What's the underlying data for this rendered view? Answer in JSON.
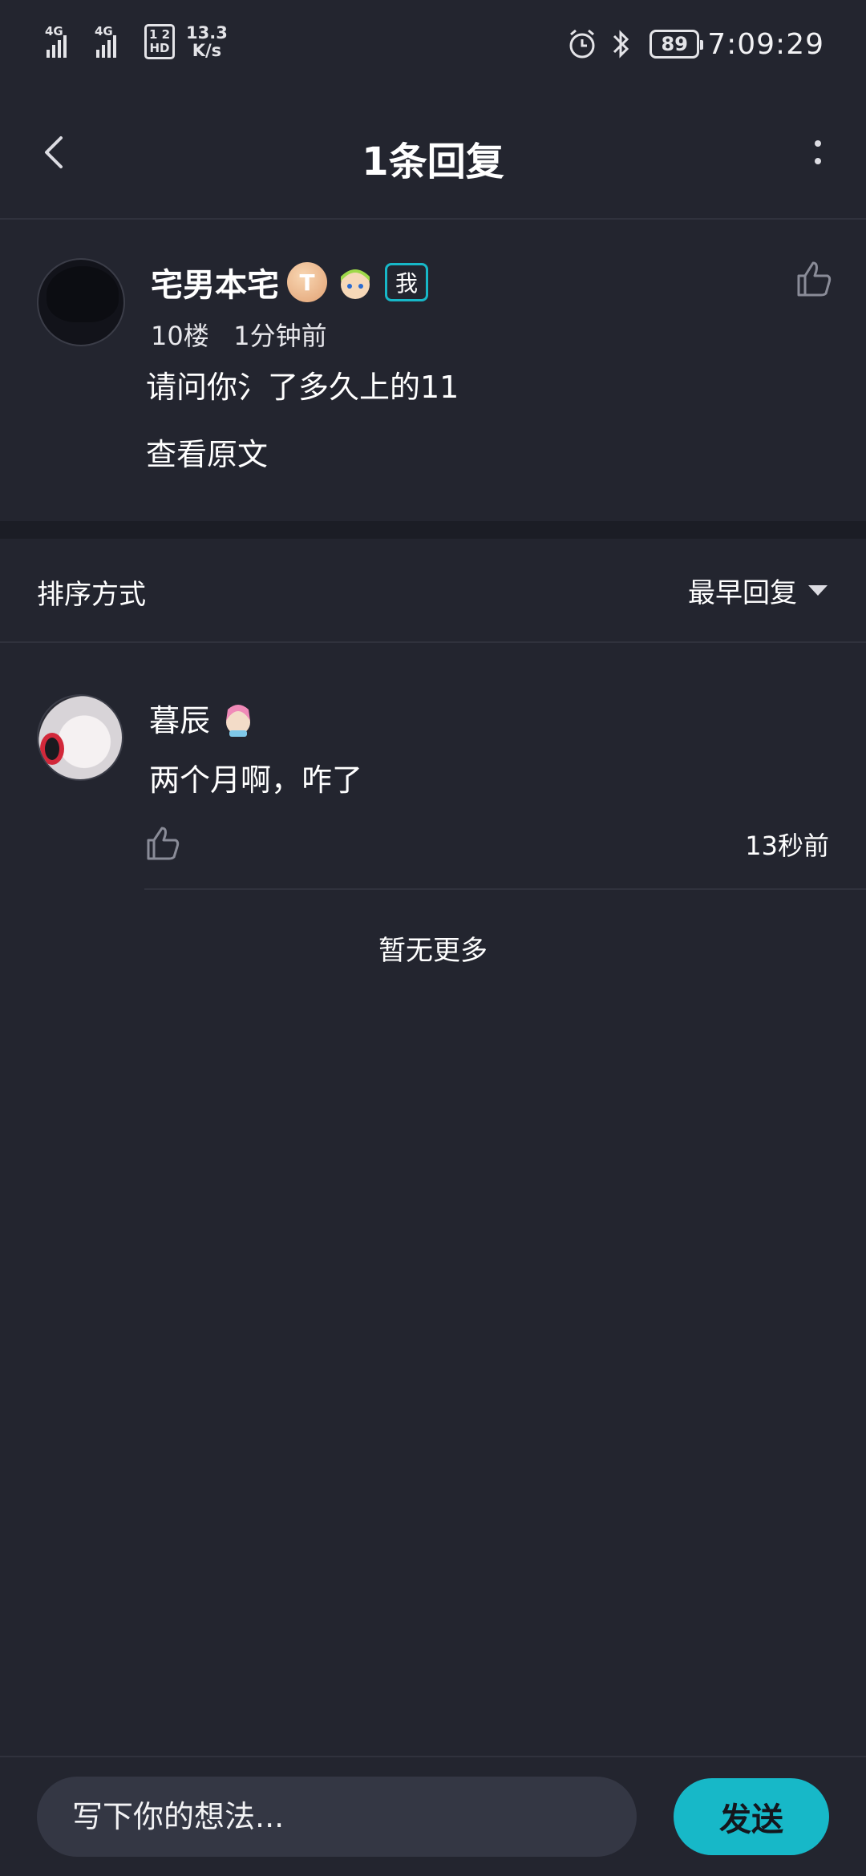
{
  "status_bar": {
    "network_1": "4G",
    "network_2": "4G",
    "hd_badge": "1 2\nHD",
    "speed_value": "13.3",
    "speed_unit": "K/s",
    "battery": "89",
    "time": "7:09:29"
  },
  "header": {
    "title": "1条回复"
  },
  "comment": {
    "author": "宅男本宅",
    "level_badge": "T",
    "me_tag": "我",
    "floor": "10楼",
    "time": "1分钟前",
    "text": "请问你氵了多久上的11",
    "view_original": "查看原文"
  },
  "sort": {
    "label": "排序方式",
    "selected": "最早回复"
  },
  "replies": [
    {
      "author": "暮辰",
      "text": "两个月啊，咋了",
      "time": "13秒前"
    }
  ],
  "list_end": "暂无更多",
  "composer": {
    "placeholder": "写下你的想法...",
    "send_label": "发送"
  },
  "colors": {
    "background": "#23252f",
    "accent": "#17b8c8",
    "divider": "#30323d"
  },
  "icons": [
    "back-icon",
    "more-icon",
    "thumb-up-icon",
    "caret-down-icon",
    "alarm-icon",
    "bluetooth-icon"
  ]
}
